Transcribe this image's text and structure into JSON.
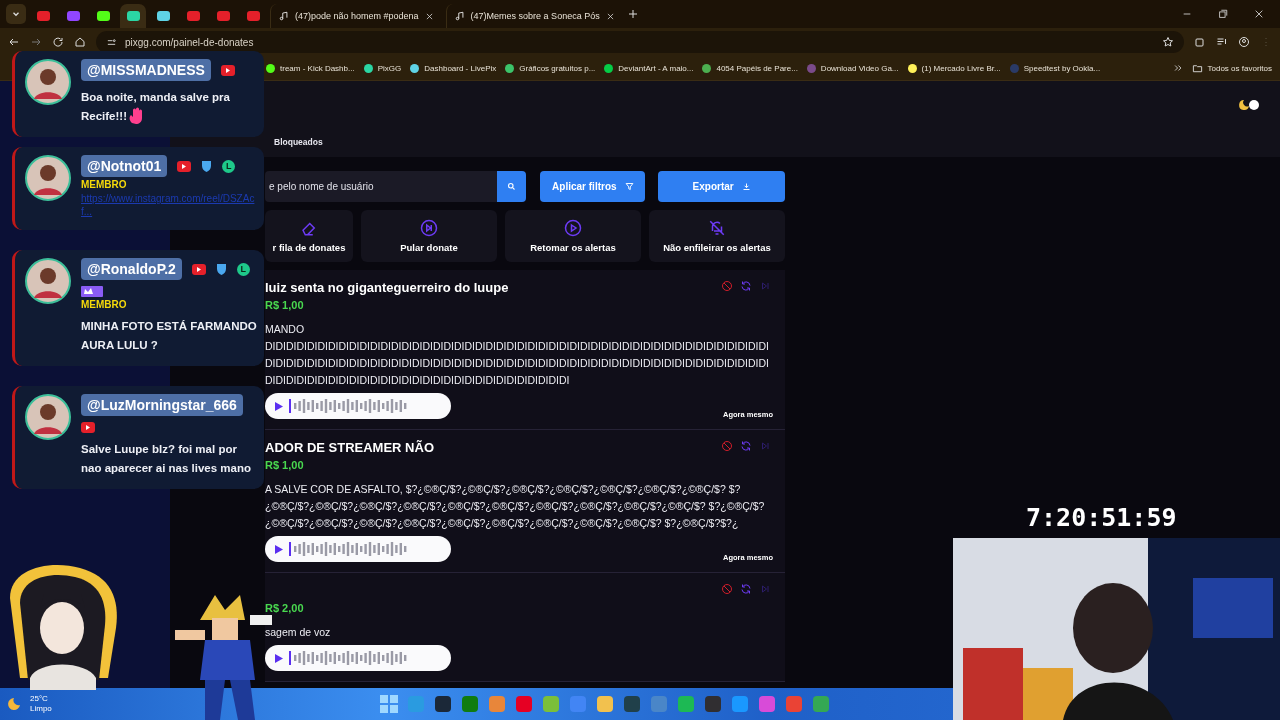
{
  "browser": {
    "tabs": [
      {
        "kind": "pinned",
        "color": "#e5202a",
        "selected": false
      },
      {
        "kind": "pinned",
        "color": "#9146ff",
        "selected": false
      },
      {
        "kind": "pinned",
        "color": "#53fc18",
        "selected": false
      },
      {
        "kind": "pinned",
        "color": "#2bd6a4",
        "selected": true
      },
      {
        "kind": "pinned",
        "color": "#5fd3e6",
        "selected": false
      },
      {
        "kind": "pinned",
        "color": "#e5202a",
        "selected": false
      },
      {
        "kind": "pinned",
        "color": "#e5202a",
        "selected": false
      },
      {
        "kind": "pinned",
        "color": "#e5202a",
        "selected": false
      },
      {
        "kind": "page",
        "title": "(47)pode não homem #podena",
        "selected": false
      },
      {
        "kind": "page",
        "title": "(47)Memes sobre a Soneca Pós",
        "selected": false
      }
    ],
    "address": "pixgg.com/painel-de-donates",
    "bookmarks": [
      {
        "label": "tream - Kick Dashb...",
        "color": "#53fc18"
      },
      {
        "label": "PixGG",
        "color": "#2bd6a4"
      },
      {
        "label": "Dashboard - LivePix",
        "color": "#5fd3e6"
      },
      {
        "label": "Gráficos gratuitos p...",
        "color": "#3cc46a"
      },
      {
        "label": "DeviantArt - A maio...",
        "color": "#05cc47"
      },
      {
        "label": "4054 Papéis de Pare...",
        "color": "#4caf50"
      },
      {
        "label": "Download Video Ga...",
        "color": "#7a4a8a"
      },
      {
        "label": "(1) Mercado Livre Br...",
        "color": "#fff159"
      },
      {
        "label": "Speedtest by Ookla...",
        "color": "#2a3a66"
      }
    ],
    "all_bookmarks": "Todos os favoritos"
  },
  "page": {
    "tab": "Bloqueados",
    "search": {
      "placeholder": "e pelo nome de usuário"
    },
    "filter_button": "Aplicar filtros",
    "export_button": "Exportar",
    "actions": [
      {
        "kind": "clear",
        "label": "r fila de donates"
      },
      {
        "kind": "skip",
        "label": "Pular donate"
      },
      {
        "kind": "resume",
        "label": "Retomar os alertas"
      },
      {
        "kind": "mute",
        "label": "Não enfileirar os alertas"
      }
    ],
    "donations": [
      {
        "title": "luiz senta no giganteguerreiro do luupe",
        "amount": "R$ 1,00",
        "message": "MANDO DIDIDIDIDIDIDIDIDIDIDIDIDIDIDIDIDIDIDIDIDIDIDIDIDIDIDIDIDIDIDIDIDIDIDIDIDIDIDIDIDIDIDIDIDIDIDIDIDIDIDIDIDIDIDIDIDIDIDIDIDIDIDIDIDIDIDIDIDIDIDIDIDIDIDIDIDIDIDIDIDIDIDIDIDIDIDIDIDIDIDIDIDIDIDIDIDIDIDIDIDIDIDIDIDIDIDIDIDIDIDIDIDIDIDIDIDIDIDIDIDIDIDIDIDI",
        "time": "Agora mesmo"
      },
      {
        "title": "ADOR DE STREAMER NÃO",
        "amount": "R$ 1,00",
        "message": "A SALVE COR DE ASFALTO, $?¿©®Ç/$?¿©®Ç/$?¿©®Ç/$?¿©®Ç/$?¿©®Ç/$?¿©®Ç/$?¿©®Ç/$? $?¿©®Ç/$?¿©®Ç/$?¿©®Ç/$?¿©®Ç/$?¿©®Ç/$?¿©®Ç/$?¿©®Ç/$?¿©®Ç/$?¿©®Ç/$?¿©®Ç/$? $?¿©®Ç/$?¿©®Ç/$?¿©®Ç/$?¿©®Ç/$?¿©®Ç/$?¿©®Ç/$?¿©®Ç/$?¿©®Ç/$?¿©®Ç/$?¿©®Ç/$? $?¿©®Ç/$?$?¿",
        "time": "Agora mesmo"
      },
      {
        "amount": "R$ 2,00",
        "message": "sagem de voz"
      }
    ]
  },
  "chat": [
    {
      "username": "@MISSMADNESS",
      "badges": [
        {
          "kind": "video"
        }
      ],
      "message": "Boa noite, manda salve pra Recife!!!",
      "wave": true
    },
    {
      "username": "@Notnot01",
      "badges": [
        {
          "kind": "video"
        },
        {
          "kind": "shield"
        },
        {
          "kind": "letter",
          "text": "L"
        }
      ],
      "role": "MEMBRO",
      "link": "https://www.instagram.com/reel/DSZAcf..."
    },
    {
      "username": "@RonaldoP.2",
      "badges": [
        {
          "kind": "video"
        },
        {
          "kind": "shield"
        },
        {
          "kind": "letter",
          "text": "L"
        },
        {
          "kind": "crown"
        }
      ],
      "role": "MEMBRO",
      "message": "MINHA FOTO ESTÁ FARMANDO AURA LULU ?"
    },
    {
      "username": "@LuzMorningstar_666",
      "badges": [
        {
          "kind": "video"
        }
      ],
      "message": "Salve Luupe blz? foi mal por nao aparecer ai nas lives mano"
    }
  ],
  "timer": "7:20:51:59",
  "taskbar": {
    "temperature": "25°C",
    "weather": "Limpo"
  }
}
